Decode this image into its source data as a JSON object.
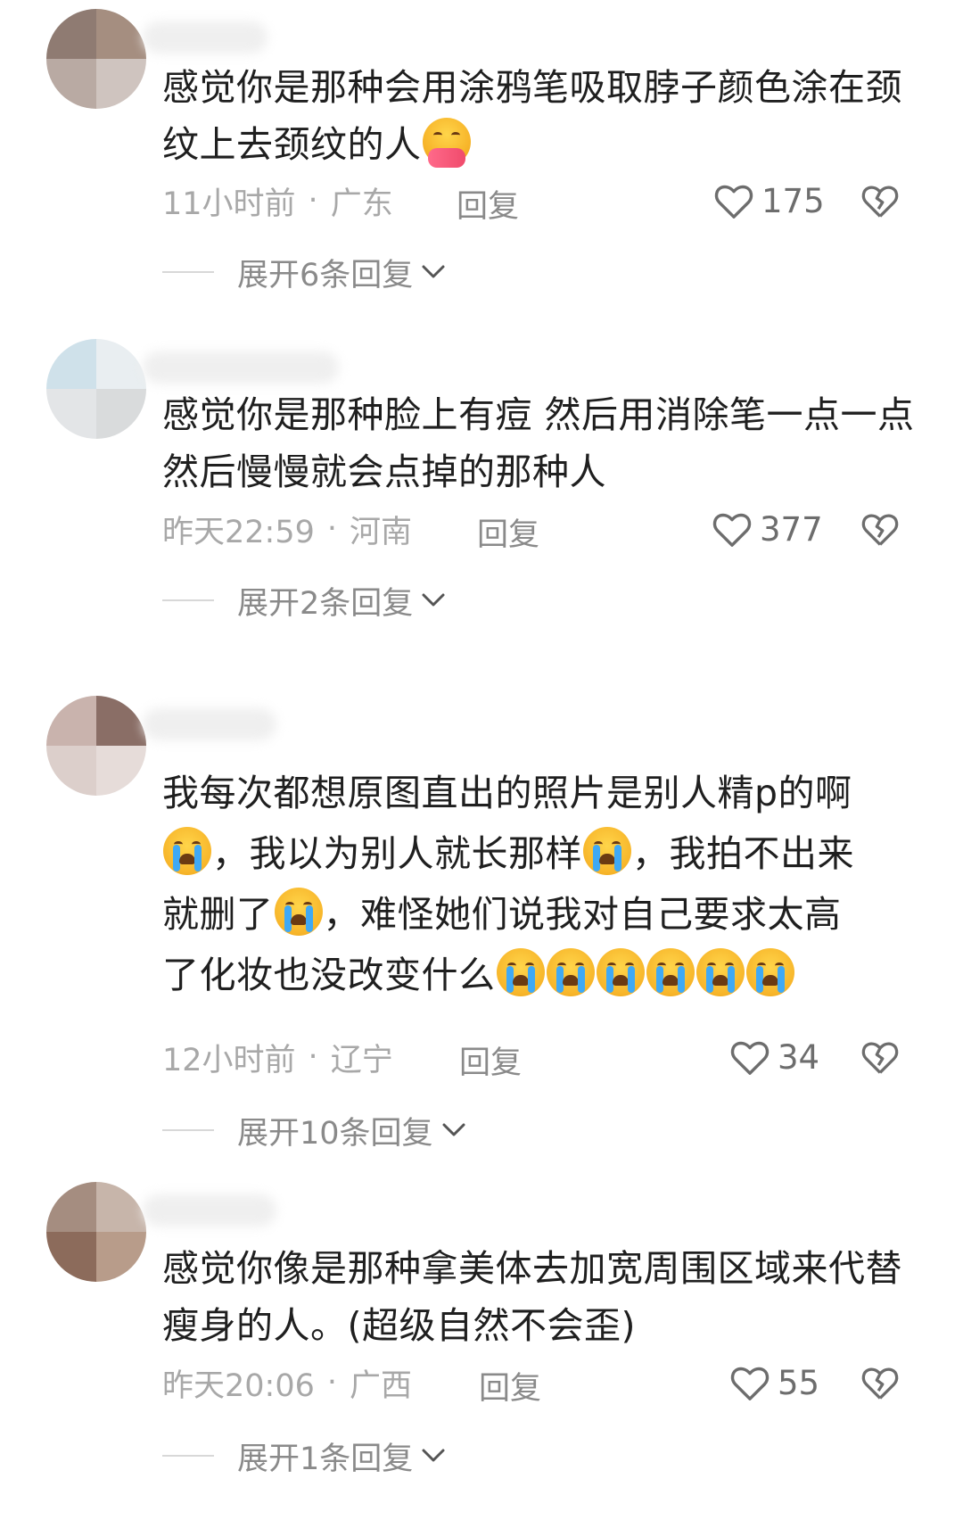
{
  "comments": [
    {
      "text_before": "感觉你是那种会用涂鸦笔吸取脖子颜色涂在颈纹上去颈纹的人",
      "emoji": "hugging-face",
      "time": "11小时前",
      "location": "广东",
      "reply_label": "回复",
      "likes": "175",
      "expand_label": "展开6条回复"
    },
    {
      "text_before": "感觉你是那种脸上有痘 然后用消除笔一点一点 然后慢慢就会点掉的那种人",
      "time": "昨天22:59",
      "location": "河南",
      "reply_label": "回复",
      "likes": "377",
      "expand_label": "展开2条回复"
    },
    {
      "line1": "我每次都想原图直出的照片是别人精p的啊",
      "seg2": "，我以为别人就长那样",
      "seg3": "，我拍不出来",
      "seg4": "就删了",
      "seg5": "，难怪她们说我对自己要求太高",
      "seg6": "了化妆也没改变什么",
      "emoji": "loudly-crying-face",
      "time": "12小时前",
      "location": "辽宁",
      "reply_label": "回复",
      "likes": "34",
      "expand_label": "展开10条回复"
    },
    {
      "text_before": "感觉你像是那种拿美体去加宽周围区域来代替瘦身的人。(超级自然不会歪)",
      "time": "昨天20:06",
      "location": "广西",
      "reply_label": "回复",
      "likes": "55",
      "expand_label": "展开1条回复"
    }
  ],
  "separator": "·",
  "icons": {
    "like": "heart-outline-icon",
    "dislike": "broken-heart-icon",
    "expand": "chevron-down-icon"
  }
}
